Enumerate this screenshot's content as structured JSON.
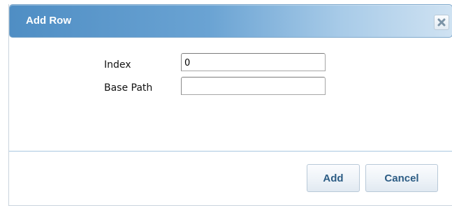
{
  "dialog": {
    "title": "Add Row",
    "close_icon": "close-icon"
  },
  "form": {
    "index": {
      "label": "Index",
      "value": "0"
    },
    "base_path": {
      "label": "Base Path",
      "value": ""
    }
  },
  "buttons": {
    "add_label": "Add",
    "cancel_label": "Cancel"
  },
  "colors": {
    "titlebar_accent": "#4f8ec4",
    "button_text": "#2c5c84",
    "separator": "#a9c8e0"
  }
}
